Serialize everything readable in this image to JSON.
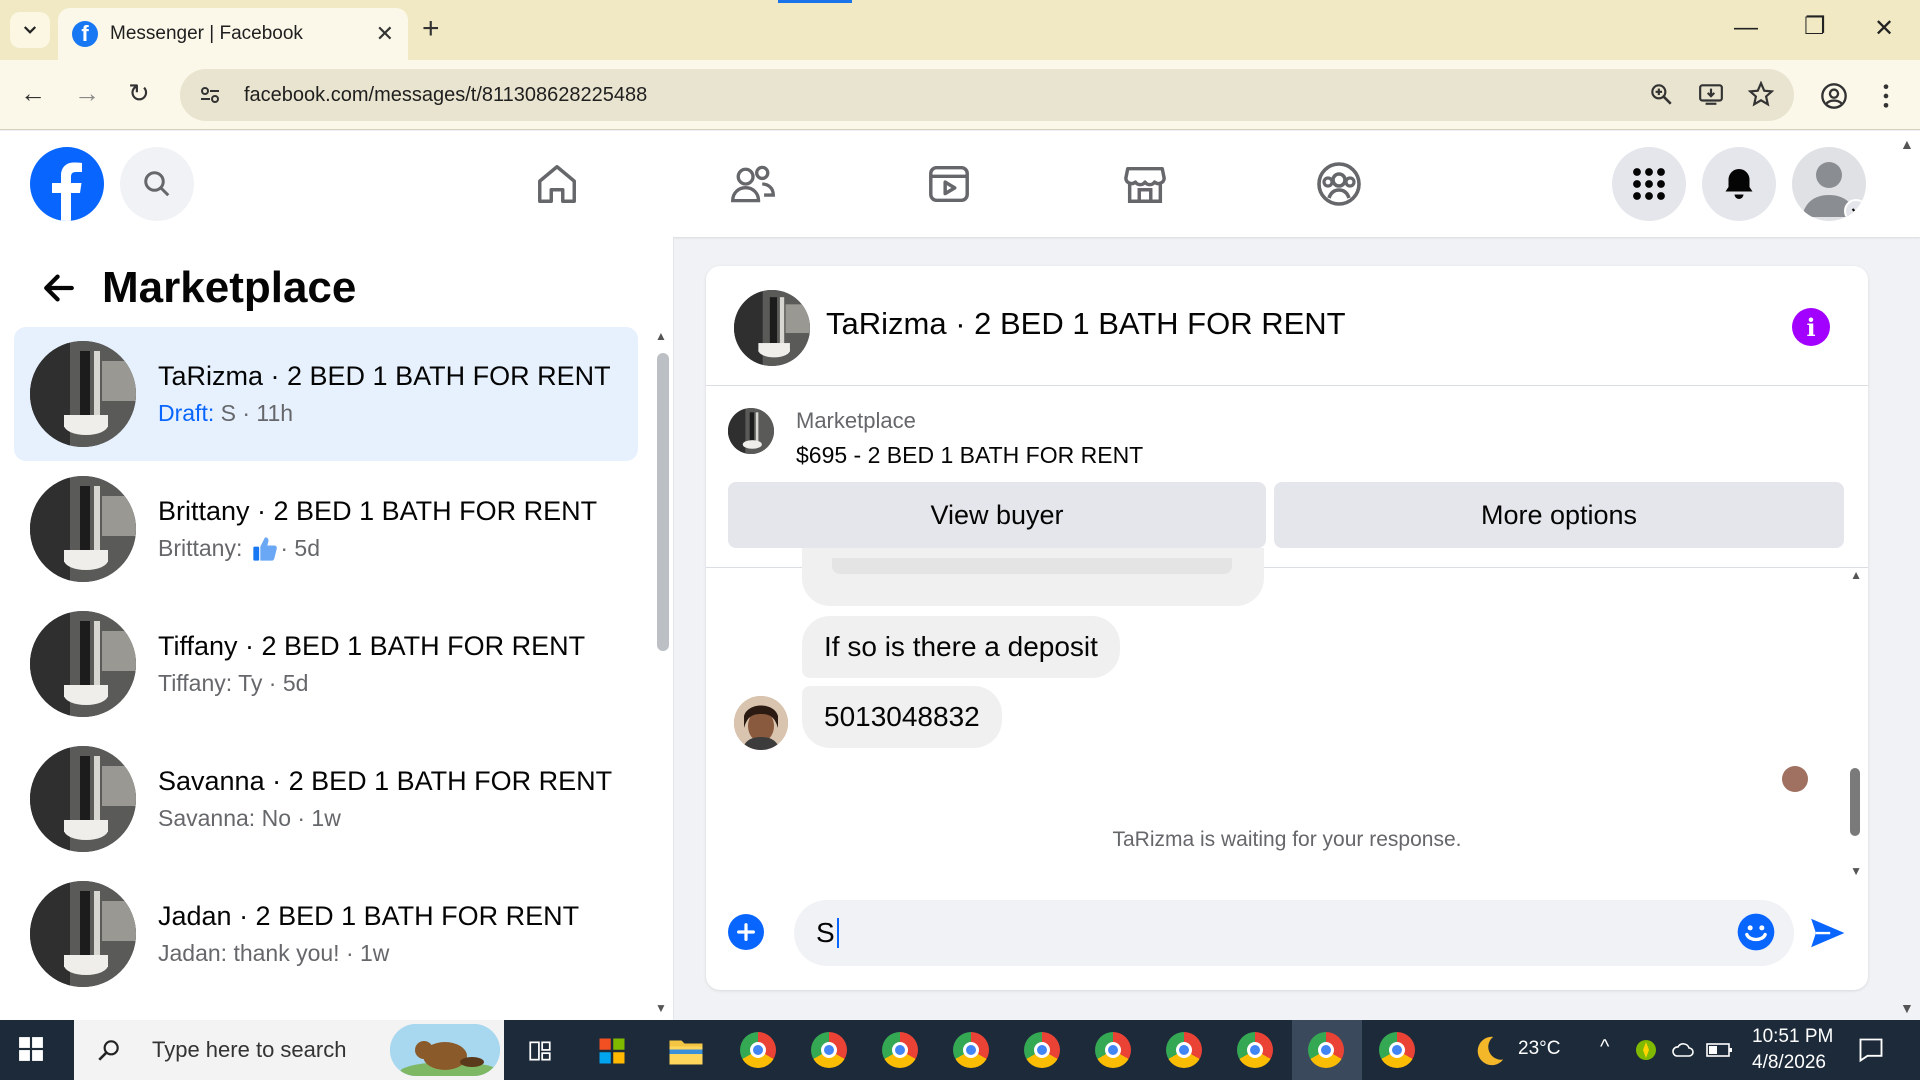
{
  "browser": {
    "tab_title": "Messenger | Facebook",
    "url": "facebook.com/messages/t/811308628225488"
  },
  "left_panel": {
    "title": "Marketplace",
    "conversations": [
      {
        "name": "TaRizma · 2 BED 1 BATH FOR RENT",
        "draft_label": "Draft:",
        "snippet": " S · 11h",
        "active": true
      },
      {
        "name": "Brittany · 2 BED 1 BATH FOR RENT",
        "snippet_prefix": "Brittany:",
        "snippet": " · 5d",
        "active": false
      },
      {
        "name": "Tiffany · 2 BED 1 BATH FOR RENT",
        "snippet": "Tiffany: Ty · 5d",
        "active": false
      },
      {
        "name": "Savanna · 2 BED 1 BATH FOR RENT",
        "snippet": "Savanna: No · 1w",
        "active": false
      },
      {
        "name": "Jadan · 2 BED 1 BATH FOR RENT",
        "snippet": "Jadan: thank you! · 1w",
        "active": false
      }
    ]
  },
  "chat": {
    "title": "TaRizma · 2 BED 1 BATH FOR RENT",
    "listing": {
      "label": "Marketplace",
      "title": "$695 - 2 BED 1 BATH FOR RENT",
      "view_buyer": "View buyer",
      "more_options": "More options"
    },
    "messages": [
      {
        "text": "If so is there a deposit"
      },
      {
        "text": "5013048832"
      }
    ],
    "waiting_text": "TaRizma is waiting for your response.",
    "composer_value": "S"
  },
  "taskbar": {
    "search_placeholder": "Type here to search",
    "temperature": "23°C",
    "time": "10:51 PM",
    "date": "4/8/2026"
  },
  "colors": {
    "facebook_blue": "#0866ff",
    "active_conversation_bg": "#e7f1fd",
    "info_purple": "#a200ff"
  },
  "icons": [
    "chevron-down-icon",
    "facebook-icon",
    "close-icon",
    "plus-icon",
    "back-icon",
    "forward-icon",
    "reload-icon",
    "site-info-icon",
    "zoom-icon",
    "install-icon",
    "star-icon",
    "profile-icon",
    "kebab-icon",
    "search-icon",
    "home-icon",
    "friends-icon",
    "video-icon",
    "marketplace-icon",
    "groups-icon",
    "grid-icon",
    "bell-icon",
    "avatar-icon",
    "arrow-left-icon",
    "thumbs-up-icon",
    "info-icon",
    "emoji-icon",
    "send-icon",
    "windows-icon",
    "moon-icon"
  ]
}
